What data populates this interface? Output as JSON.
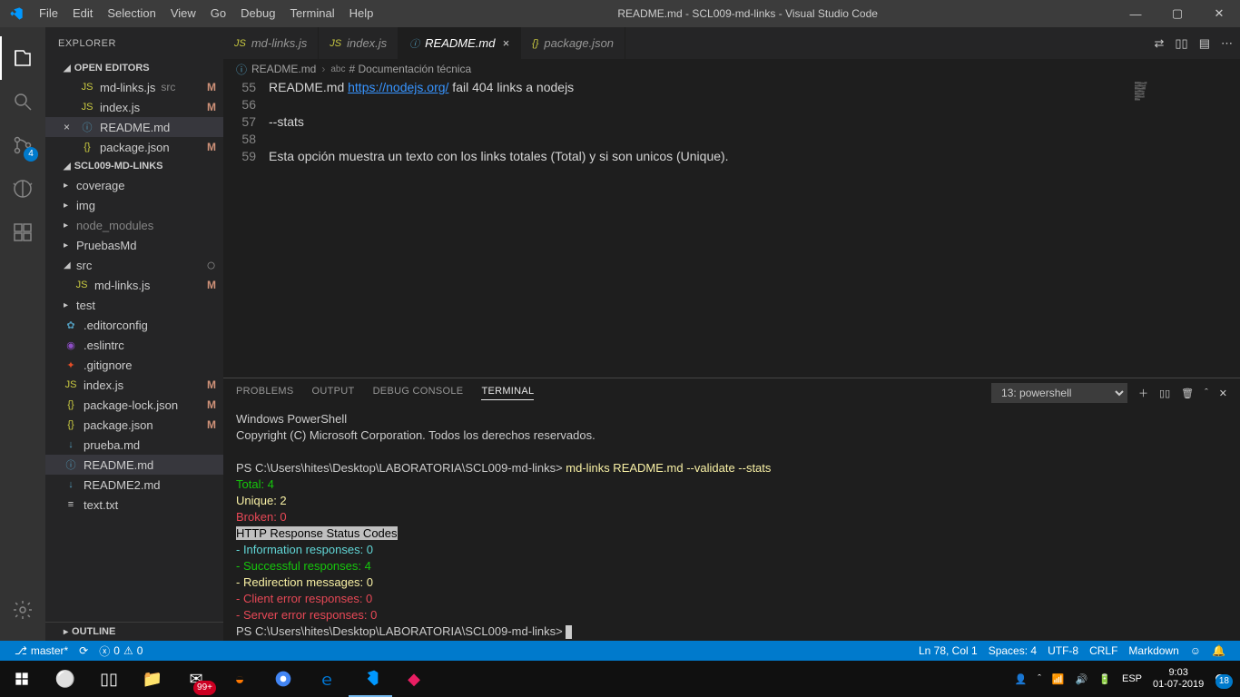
{
  "titlebar": {
    "menus": [
      "File",
      "Edit",
      "Selection",
      "View",
      "Go",
      "Debug",
      "Terminal",
      "Help"
    ],
    "title": "README.md - SCL009-md-links - Visual Studio Code"
  },
  "activitybar": {
    "scm_badge": "4"
  },
  "sidebar": {
    "header": "EXPLORER",
    "sections": {
      "openEditors": "OPEN EDITORS",
      "project": "SCL009-MD-LINKS",
      "outline": "OUTLINE"
    },
    "openEditors": [
      {
        "name": "md-links.js",
        "icon": "JS",
        "iconClass": "js-color",
        "status": "M",
        "path": "src"
      },
      {
        "name": "index.js",
        "icon": "JS",
        "iconClass": "js-color",
        "status": "M"
      },
      {
        "name": "README.md",
        "icon": "ⓘ",
        "iconClass": "info-color",
        "status": "",
        "active": true,
        "close": true
      },
      {
        "name": "package.json",
        "icon": "{}",
        "iconClass": "json-color",
        "status": "M"
      }
    ],
    "tree": [
      {
        "type": "folder",
        "name": "coverage",
        "open": false
      },
      {
        "type": "folder",
        "name": "img",
        "open": false
      },
      {
        "type": "folder",
        "name": "node_modules",
        "open": false,
        "dim": true
      },
      {
        "type": "folder",
        "name": "PruebasMd",
        "open": false
      },
      {
        "type": "folder",
        "name": "src",
        "open": true
      },
      {
        "type": "file",
        "name": "md-links.js",
        "icon": "JS",
        "iconClass": "js-color",
        "status": "M",
        "indent": true
      },
      {
        "type": "folder",
        "name": "test",
        "open": false
      },
      {
        "type": "file",
        "name": ".editorconfig",
        "icon": "✿",
        "iconClass": "info-color"
      },
      {
        "type": "file",
        "name": ".eslintrc",
        "icon": "◉",
        "iconClass": "",
        "iconColor": "#8e4ec6"
      },
      {
        "type": "file",
        "name": ".gitignore",
        "icon": "✦",
        "iconClass": "",
        "iconColor": "#e44d26"
      },
      {
        "type": "file",
        "name": "index.js",
        "icon": "JS",
        "iconClass": "js-color",
        "status": "M"
      },
      {
        "type": "file",
        "name": "package-lock.json",
        "icon": "{}",
        "iconClass": "json-color",
        "status": "M"
      },
      {
        "type": "file",
        "name": "package.json",
        "icon": "{}",
        "iconClass": "json-color",
        "status": "M"
      },
      {
        "type": "file",
        "name": "prueba.md",
        "icon": "↓",
        "iconClass": "md-color"
      },
      {
        "type": "file",
        "name": "README.md",
        "icon": "ⓘ",
        "iconClass": "info-color",
        "selected": true
      },
      {
        "type": "file",
        "name": "README2.md",
        "icon": "↓",
        "iconClass": "md-color"
      },
      {
        "type": "file",
        "name": "text.txt",
        "icon": "≡",
        "iconClass": ""
      }
    ]
  },
  "tabs": [
    {
      "name": "md-links.js",
      "icon": "JS",
      "iconClass": "js-color"
    },
    {
      "name": "index.js",
      "icon": "JS",
      "iconClass": "js-color"
    },
    {
      "name": "README.md",
      "icon": "ⓘ",
      "iconClass": "info-color",
      "active": true,
      "close": true
    },
    {
      "name": "package.json",
      "icon": "{}",
      "iconClass": "json-color"
    }
  ],
  "breadcrumb": {
    "file": "README.md",
    "symbol": "# Documentación técnica",
    "symbolPrefix": "abc"
  },
  "code": {
    "lines": [
      {
        "n": "55",
        "text": "README.md ",
        "link": "https://nodejs.org/",
        "after": " fail 404 links a nodejs"
      },
      {
        "n": "56",
        "text": ""
      },
      {
        "n": "57",
        "text": "--stats"
      },
      {
        "n": "58",
        "text": ""
      },
      {
        "n": "59",
        "text": "Esta opción muestra un texto con los links totales (Total) y si son unicos (Unique)."
      }
    ]
  },
  "panel": {
    "tabs": [
      "PROBLEMS",
      "OUTPUT",
      "DEBUG CONSOLE",
      "TERMINAL"
    ],
    "activeTab": 3,
    "terminalSelector": "13: powershell",
    "terminal": {
      "header1": "Windows PowerShell",
      "header2": "Copyright (C) Microsoft Corporation. Todos los derechos reservados.",
      "prompt1_a": "PS C:\\Users\\hites\\Desktop\\LABORATORIA\\SCL009-md-links> ",
      "prompt1_cmd": "md-links README.md --validate --stats",
      "total": "Total: 4",
      "unique": "Unique: 2",
      "broken": "Broken: 0",
      "httpHeader": "HTTP Response Status Codes",
      "info": "- Information responses: 0",
      "success": "- Successful responses: 4",
      "redirect": "- Redirection messages: 0",
      "clienterr": "- Client error responses: 0",
      "servererr": "- Server error responses: 0",
      "prompt2": "PS C:\\Users\\hites\\Desktop\\LABORATORIA\\SCL009-md-links> "
    }
  },
  "statusbar": {
    "branch": "master*",
    "errors": "0",
    "warnings": "0",
    "lncol": "Ln 78, Col 1",
    "spaces": "Spaces: 4",
    "encoding": "UTF-8",
    "eol": "CRLF",
    "lang": "Markdown"
  },
  "taskbar": {
    "lang": "ESP",
    "time": "9:03",
    "date": "01-07-2019",
    "notif": "18",
    "mail": "99+"
  }
}
